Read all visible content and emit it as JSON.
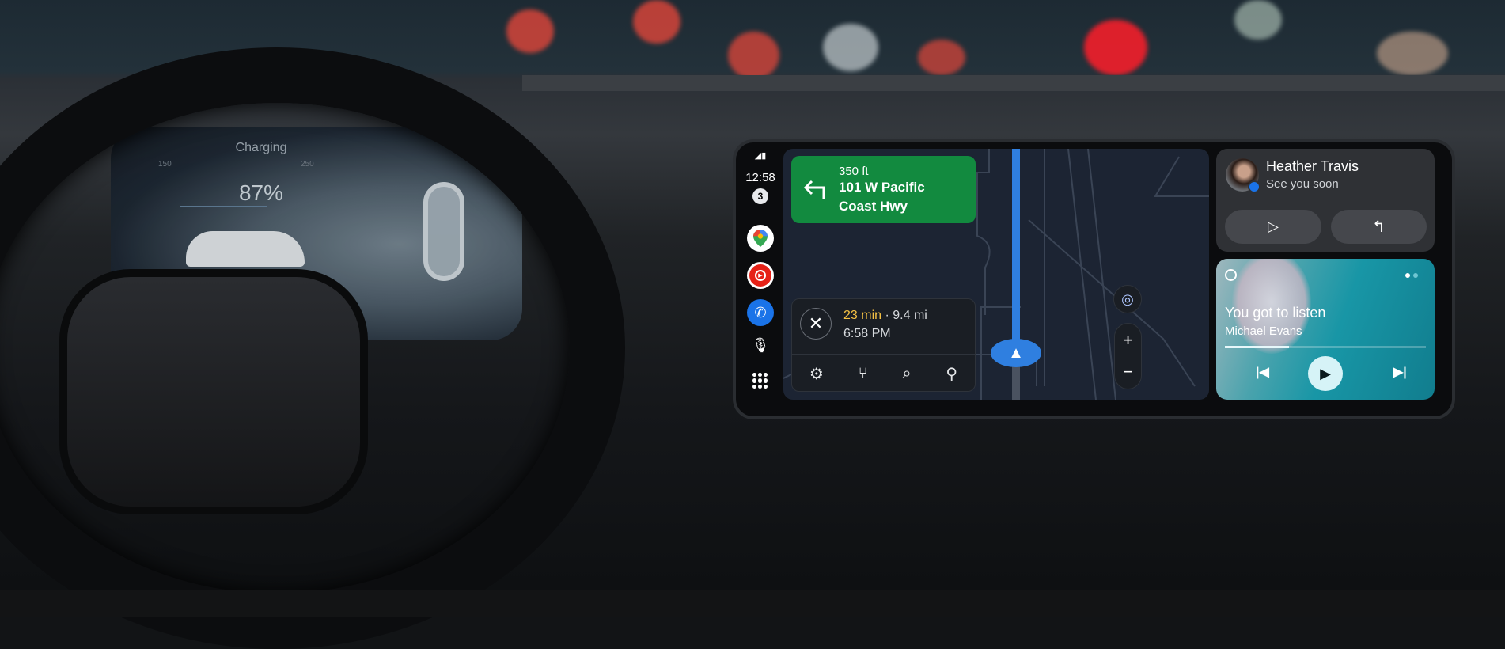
{
  "cluster": {
    "title": "Charging",
    "battery": "87%",
    "tick_left": "150",
    "tick_right": "250"
  },
  "status": {
    "time": "12:58",
    "notification_count": "3"
  },
  "rail": {
    "apps": [
      {
        "name": "Google Maps",
        "icon": "maps-icon"
      },
      {
        "name": "YouTube Music",
        "icon": "youtube-music-icon",
        "color": "#e62117"
      },
      {
        "name": "Phone",
        "icon": "phone-icon",
        "color": "#1a73e8"
      }
    ]
  },
  "navigation": {
    "distance": "350 ft",
    "street_line1": "101 W Pacific",
    "street_line2": "Coast Hwy",
    "turn": "left",
    "card_color": "#128a3f"
  },
  "trip": {
    "eta": "23 min",
    "separator": " · ",
    "distance": "9.4 mi",
    "arrival": "6:58 PM",
    "eta_color": "#f6c244"
  },
  "message": {
    "sender": "Heather Travis",
    "text": "See you soon"
  },
  "media": {
    "title": "You got to listen",
    "artist": "Michael Evans",
    "progress": 0.32,
    "page_count": 2,
    "active_page": 1
  },
  "colors": {
    "route": "#2f7fe0",
    "map_bg": "#1c2433"
  }
}
